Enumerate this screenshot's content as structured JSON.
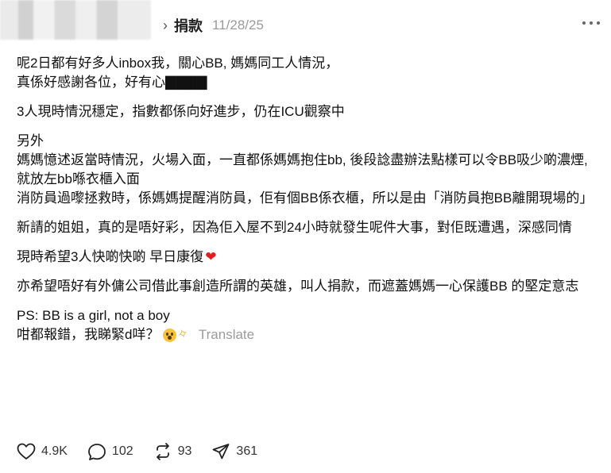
{
  "header": {
    "topic": "捐款",
    "date": "11/28/25"
  },
  "post": {
    "p1": "呢2日都有好多人inbox我，關心BB, 媽媽同工人情況，\n真係好感謝各位，好有心▇▇▇▇",
    "p2": "3人現時情況穩定，指數都係向好進步，仍在ICU觀察中",
    "p3": "另外\n媽媽憶述返當時情況，火場入面，一直都係媽媽抱住bb, 後段諗盡辦法點樣可以令BB吸少啲濃煙, 就放左bb喺衣櫃入面\n消防員過嚟拯救時，係媽媽提醒消防員，佢有個BB係衣櫃，所以是由「消防員抱BB離開現場的」",
    "p4": "新請的姐姐，真的是唔好彩，因為佢入屋不到24小時就發生呢件大事，對佢既遭遇，深感同情",
    "p5": "現時希望3人快啲快啲 早日康復",
    "p6": "亦希望唔好有外傭公司借此事創造所謂的英雄，叫人捐款，而遮蓋媽媽一心保護BB 的堅定意志",
    "p7a": "PS: BB is a girl, not a boy",
    "p7b": "咁都報錯，我睇緊d咩？",
    "translate": "Translate"
  },
  "actions": {
    "likes": "4.9K",
    "replies": "102",
    "reposts": "93",
    "shares": "361"
  },
  "icons": [
    "chevron-right-icon",
    "more-icon",
    "heart-icon",
    "reply-icon",
    "repost-icon",
    "share-icon"
  ]
}
